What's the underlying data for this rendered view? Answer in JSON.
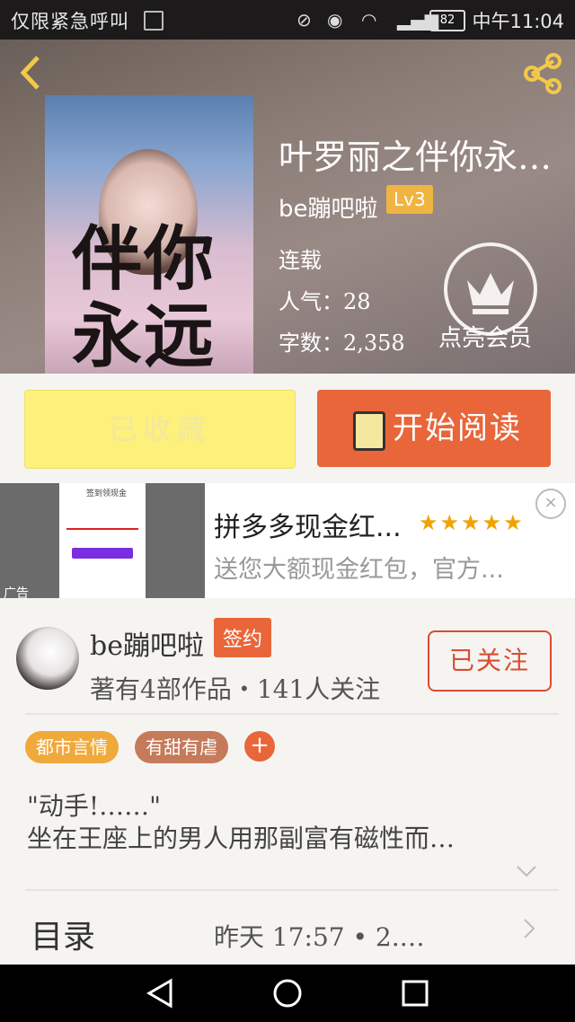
{
  "status_bar": {
    "carrier": "仅限紧急呼叫",
    "battery": "82",
    "time": "中午11:04"
  },
  "book": {
    "cover_text": "伴你\n永远",
    "title": "叶罗丽之伴你永…",
    "author": "be蹦吧啦",
    "level": "Lv3",
    "status": "连载",
    "popularity": "人气：28",
    "words": "字数：2,358",
    "vip_label": "点亮会员"
  },
  "actions": {
    "collected_label": "已收藏",
    "read_label": "开始阅读"
  },
  "ad": {
    "phone_title": "签到领现金",
    "tag": "广告",
    "title": "拼多多现金红...",
    "stars": "★★★★★",
    "desc": "送您大额现金红包，官方...",
    "close": "×"
  },
  "author_card": {
    "name": "be蹦吧啦",
    "badge": "签约",
    "info": "著有4部作品・141人关注",
    "follow_label": "已关注"
  },
  "tags": [
    "都市言情",
    "有甜有虐"
  ],
  "tag_add": "+",
  "synopsis": "\"动手!……\"\n坐在王座上的男人用那副富有磁性而…",
  "toc": {
    "label": "目录",
    "update": "昨天  17:57  •  2.…"
  },
  "colors": {
    "accent": "#e8663a",
    "level_badge": "#f0b441",
    "collected_bg": "#fdf07b"
  }
}
